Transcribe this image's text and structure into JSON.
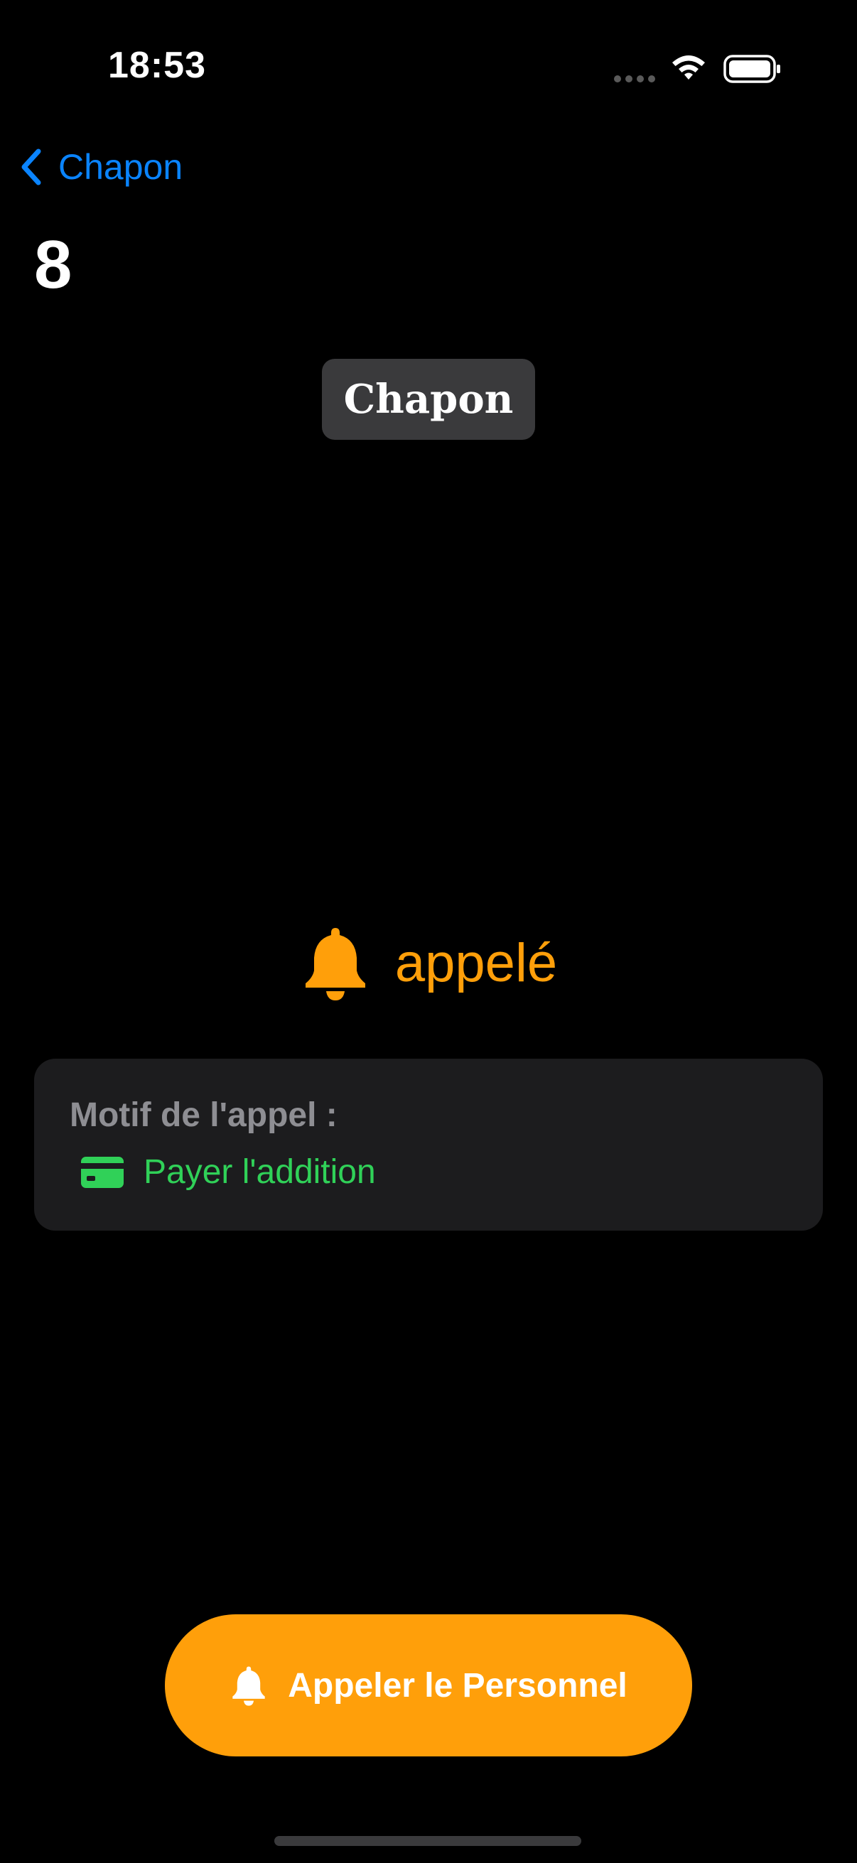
{
  "status_bar": {
    "time": "18:53",
    "icons": [
      "cellular-signal-icon",
      "wifi-icon",
      "battery-icon"
    ]
  },
  "nav": {
    "back_label": "Chapon",
    "page_number": "8"
  },
  "badge": {
    "name": "Chapon"
  },
  "call_status": {
    "icon": "bell-icon",
    "label": "appelé"
  },
  "reason": {
    "title": "Motif de l'appel :",
    "item_icon": "credit-card-icon",
    "item_label": "Payer l'addition"
  },
  "call_button": {
    "icon": "bell-icon",
    "label": "Appeler le Personnel"
  },
  "colors": {
    "accent_blue": "#0a84ff",
    "accent_orange": "#ff9f0a",
    "accent_green": "#30d158",
    "card_background": "#1c1c1e",
    "badge_background": "#3a3a3c",
    "secondary_text": "#8e8e93"
  }
}
